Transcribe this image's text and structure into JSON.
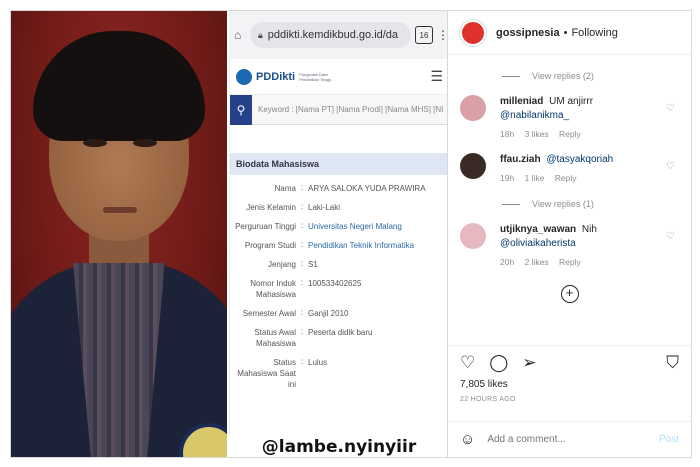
{
  "browser": {
    "url": "pddikti.kemdikbud.go.id/da",
    "tab_count": "16"
  },
  "site": {
    "logo_text": "PDDikti",
    "logo_sub": "Pangkalan Data Pendidikan Tinggi",
    "search_placeholder": "Keyword : [Nama PT] [Nama Prodi] [Nama MHS] [NI"
  },
  "biodata": {
    "heading": "Biodata Mahasiswa",
    "rows": [
      {
        "key": "Nama",
        "value": "ARYA SALOKA YUDA PRAWIRA"
      },
      {
        "key": "Jenis Kelamin",
        "value": "Laki-Laki"
      },
      {
        "key": "Perguruan Tinggi",
        "value": "Universitas Negeri Malang"
      },
      {
        "key": "Program Studi",
        "value": "Pendidikan Teknik Informatika"
      },
      {
        "key": "Jenjang",
        "value": "S1"
      },
      {
        "key": "Nomor Induk Mahasiswa",
        "value": "100533402625"
      },
      {
        "key": "Semester Awal",
        "value": "Ganjil 2010"
      },
      {
        "key": "Status Awal Mahasiswa",
        "value": "Peserta didik baru"
      },
      {
        "key": "Status Mahasiswa Saat ini",
        "value": "Lulus"
      }
    ]
  },
  "watermark": "@lambe.nyinyiir",
  "instagram": {
    "username": "gossipnesia",
    "follow_status": "Following",
    "view_replies_1": "View replies (2)",
    "comments": [
      {
        "user": "milleniad",
        "text": "UM anjirrr",
        "mention": "@nabilanikma_",
        "time": "18h",
        "likes": "3 likes",
        "reply": "Reply",
        "avatar_color": "#d9a0a8"
      },
      {
        "user": "ffau.ziah",
        "text": "",
        "mention": "@tasyakqoriah",
        "time": "19h",
        "likes": "1 like",
        "reply": "Reply",
        "avatar_color": "#3a2a26"
      },
      {
        "user": "utjiknya_wawan",
        "text": "Nih",
        "mention": "@oliviaikaherista",
        "time": "20h",
        "likes": "2 likes",
        "reply": "Reply",
        "avatar_color": "#e8b8c0"
      }
    ],
    "view_replies_2": "View replies (1)",
    "likes_count": "7,805 likes",
    "time_ago": "22 HOURS AGO",
    "add_comment_placeholder": "Add a comment...",
    "post_label": "Post"
  }
}
